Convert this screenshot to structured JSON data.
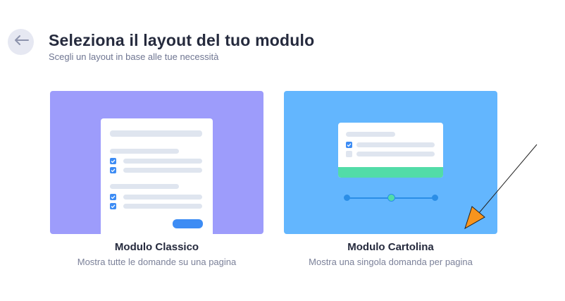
{
  "header": {
    "title": "Seleziona il layout del tuo modulo",
    "subtitle": "Scegli un layout in base alle tue necessità"
  },
  "icons": {
    "back": "arrow-left-icon",
    "check": "checkbox-checked-icon",
    "pointer": "arrow-pointer-icon"
  },
  "colors": {
    "classic_bg": "#9d9cfb",
    "cartolina_bg": "#63b6fe",
    "accent_blue": "#3d8cf4",
    "accent_green": "#52dca8",
    "pointer_orange": "#f7941d"
  },
  "layouts": [
    {
      "title": "Modulo Classico",
      "description": "Mostra tutte le domande su una pagina"
    },
    {
      "title": "Modulo Cartolina",
      "description": "Mostra una singola domanda per pagina"
    }
  ]
}
